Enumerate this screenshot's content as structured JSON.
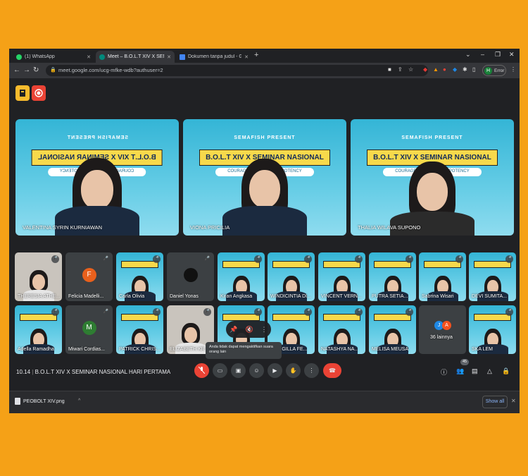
{
  "browser": {
    "tabs": [
      {
        "label": "(1) WhatsApp",
        "color": "#25d366"
      },
      {
        "label": "Meet – B.O.L.T XIV X SEMIN",
        "color": "#00897b",
        "active": true
      },
      {
        "label": "Dokumen tanpa judul - Goog",
        "color": "#4285f4"
      }
    ],
    "url": "meet.google.com/ucg-mfke-wdb?authuser=2",
    "profile_label": "Error",
    "profile_initial": "H"
  },
  "meeting": {
    "time": "10.14",
    "title": "B.O.L.T XIV X SEMINAR NASIONAL HARI PERTAMA",
    "participants_badge": "45"
  },
  "banner": {
    "presenter": "SEMAFISH PRESENT",
    "headline": "B.O.L.T XIV X SEMINAR NASIONAL",
    "tagline": "COURAGE ALWAYS BUILD POTENCY"
  },
  "speakers": [
    {
      "name": "VALENTINA SYRIN KURNIAWAN"
    },
    {
      "name": "VIONA PRICILIA"
    },
    {
      "name": "THALIA WILAVA SUPONO"
    }
  ],
  "tiles_row1": [
    {
      "name": "THERESIA ATHE...",
      "kind": "camera"
    },
    {
      "name": "Felicia Madelli...",
      "kind": "avatar",
      "initial": "F",
      "color": "#e8601c"
    },
    {
      "name": "Carla Olivia",
      "kind": "banner"
    },
    {
      "name": "Daniel Yonas",
      "kind": "avatar",
      "initial": "",
      "color": "#111111"
    },
    {
      "name": "Kiran Angkasa",
      "kind": "banner"
    },
    {
      "name": "WINDICINTIA DI...",
      "kind": "banner"
    },
    {
      "name": "VINCENT VERN...",
      "kind": "banner"
    },
    {
      "name": "PUTRA SETIA...",
      "kind": "banner"
    },
    {
      "name": "Sabrina Wisari",
      "kind": "banner"
    },
    {
      "name": "DEVI SUMITA...",
      "kind": "banner"
    }
  ],
  "tiles_row2": [
    {
      "name": "Adella Ramadha",
      "kind": "banner"
    },
    {
      "name": "Miwari Cordias...",
      "kind": "avatar",
      "initial": "M",
      "color": "#2e7d32"
    },
    {
      "name": "PATRICK CHRIS...",
      "kind": "banner"
    },
    {
      "name": "ELIZABETH KR...",
      "kind": "camera"
    },
    {
      "name": "",
      "kind": "banner"
    },
    {
      "name": "FRINGILLA FE...",
      "kind": "banner"
    },
    {
      "name": "NATASHYA NA...",
      "kind": "banner"
    },
    {
      "name": "MELISA MEUSA",
      "kind": "banner"
    },
    {
      "name": "36 lainnya",
      "kind": "others"
    },
    {
      "name": "SKA LEM",
      "kind": "banner"
    }
  ],
  "tooltip": "Anda tidak dapat mengaktifkan suara orang lain",
  "download": {
    "filename": "PEOBOLT XIV.png",
    "show_all": "Show all"
  },
  "colors": {
    "background": "#f5a117",
    "meet_bg": "#202124",
    "end_call": "#ea4335",
    "banner_blue": "#3cbbe0",
    "banner_yellow": "#f7d94b"
  }
}
